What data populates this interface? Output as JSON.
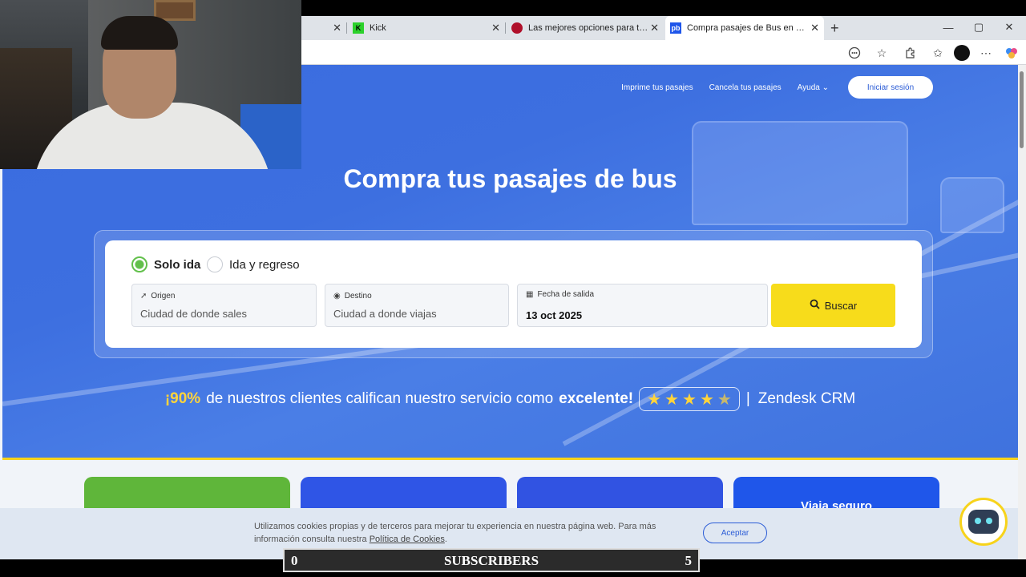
{
  "browser": {
    "tabs": [
      {
        "label": "",
        "favicon": "",
        "active": false
      },
      {
        "label": "Kick",
        "favicon": "K",
        "active": false
      },
      {
        "label": "Las mejores opciones para tus via",
        "favicon": "",
        "active": false
      },
      {
        "label": "Compra pasajes de Bus en Colom",
        "favicon": "pb",
        "active": true
      }
    ],
    "new_tab_icon": "+",
    "window_controls": {
      "minimize": "—",
      "maximize": "▢",
      "close": "✕"
    },
    "toolbar_icons": [
      "reading-icon",
      "favorite-star-icon",
      "extensions-icon",
      "favorites-icon",
      "profile-avatar-icon",
      "more-icon",
      "copilot-icon"
    ]
  },
  "nav": {
    "print": "Imprime tus pasajes",
    "cancel": "Cancela tus pasajes",
    "help": "Ayuda",
    "login": "Iniciar sesión"
  },
  "hero": {
    "title": "Compra tus pasajes de bus"
  },
  "search": {
    "trip_one_way": "Solo ida",
    "trip_round": "Ida y regreso",
    "selected_trip": "Solo ida",
    "origin_label": "Origen",
    "origin_placeholder": "Ciudad de donde sales",
    "destination_label": "Destino",
    "destination_placeholder": "Ciudad a donde viajas",
    "date_label": "Fecha de salida",
    "date_value": "13 oct 2025",
    "button": "Buscar"
  },
  "rating": {
    "percent": "¡90%",
    "text": "de nuestros clientes califican nuestro servicio como",
    "strong": "excelente!",
    "stars": 4.5,
    "separator": "|",
    "source": "Zendesk CRM"
  },
  "cards": [
    {
      "title": "",
      "color": "#5fb63a"
    },
    {
      "title": "",
      "color": "#2f55e6"
    },
    {
      "title": "",
      "color": "#3153e2"
    },
    {
      "title": "Viaja seguro",
      "color": "#1f56ea"
    }
  ],
  "cookies": {
    "text": "Utilizamos cookies propias y de terceros para mejorar tu experiencia en nuestra página web. Para más información consulta nuestra",
    "link": "Política de Cookies",
    "end": ".",
    "button": "Aceptar"
  },
  "overlay": {
    "left_count": "0",
    "label": "SUBSCRIBERS",
    "right_count": "5"
  },
  "colors": {
    "hero_blue": "#3d6fe0",
    "accent_yellow": "#f7dc1b",
    "radio_green": "#62c04b"
  }
}
